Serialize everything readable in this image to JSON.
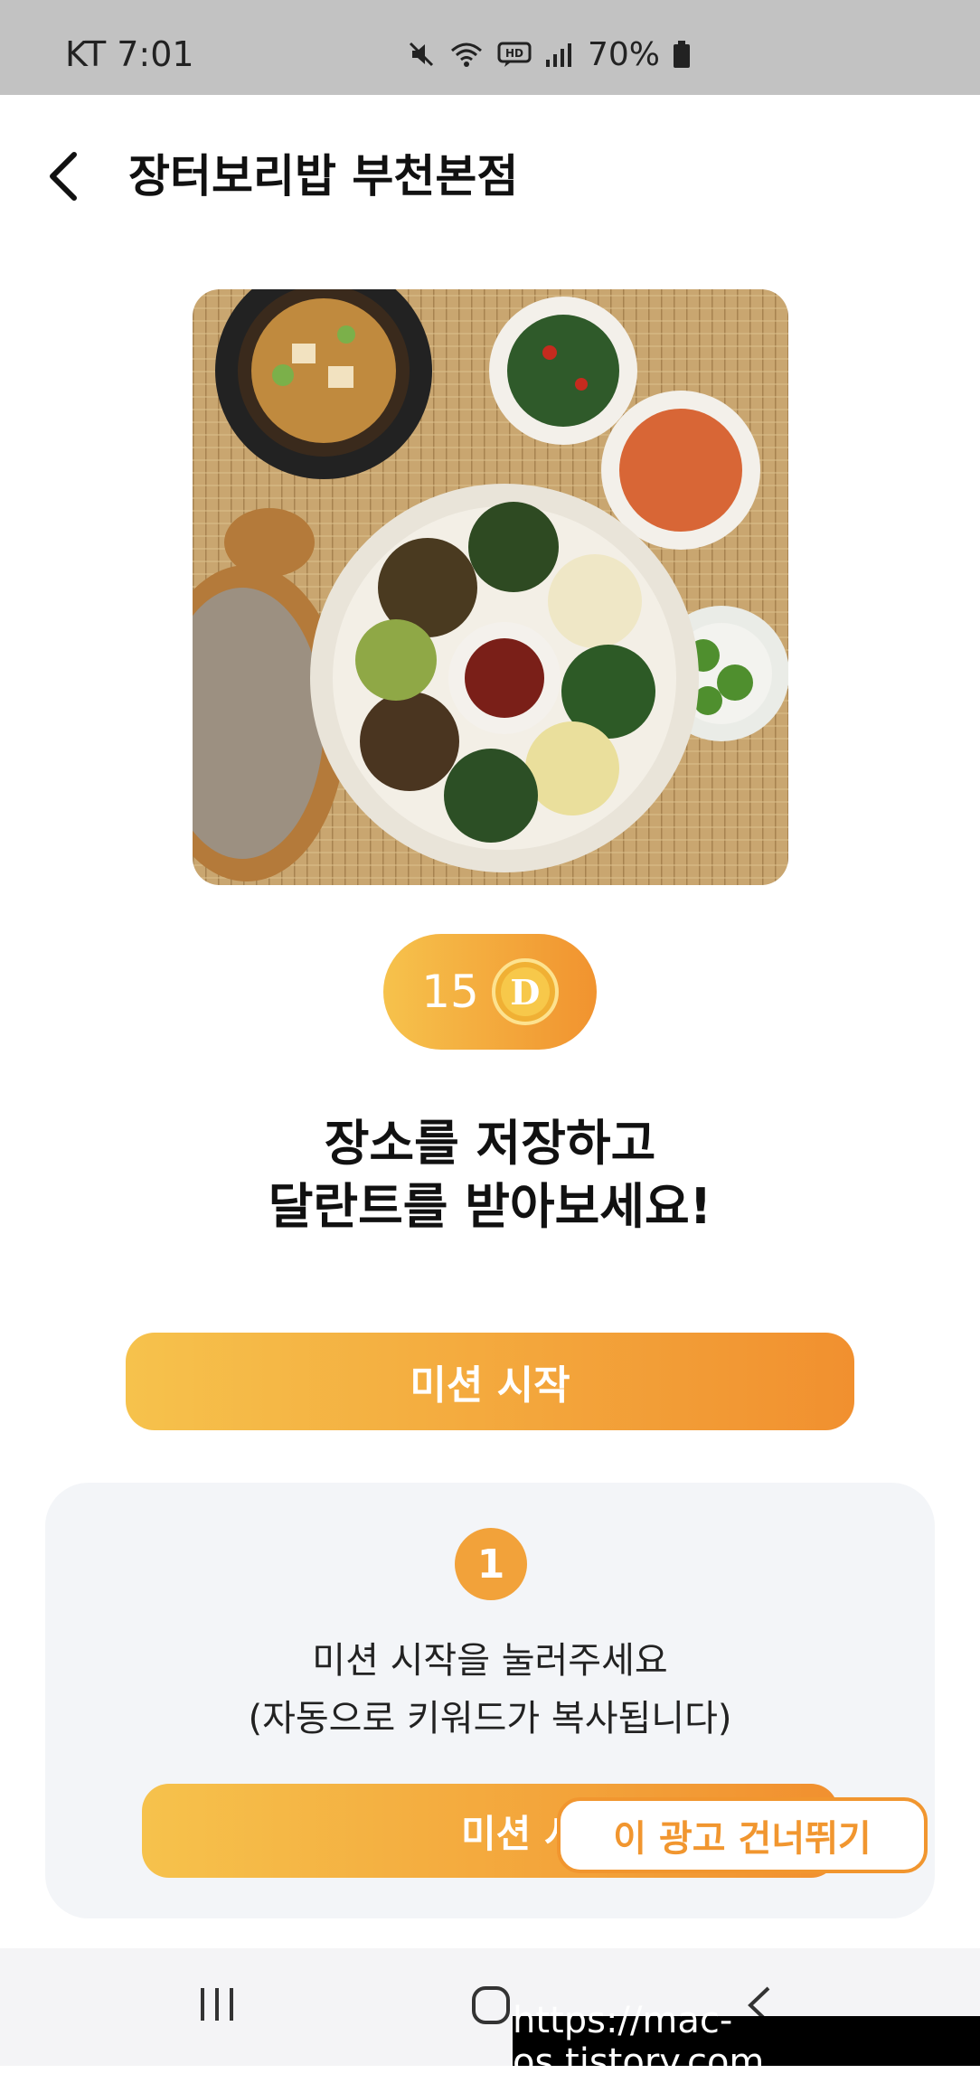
{
  "status_bar": {
    "carrier_time": "KT 7:01",
    "battery_percent": "70%",
    "icons": [
      "mute-icon",
      "wifi-icon",
      "hd-voice-icon",
      "signal-icon",
      "battery-icon"
    ]
  },
  "header": {
    "back_icon": "chevron-left-icon",
    "title": "장터보리밥 부천본점"
  },
  "reward": {
    "amount": "15",
    "coin_letter": "D"
  },
  "headline": {
    "line1": "장소를 저장하고",
    "line2": "달란트를 받아보세요!"
  },
  "mission_button": {
    "label": "미션 시작"
  },
  "steps_card": {
    "step_number": "1",
    "line1": "미션 시작을 눌러주세요",
    "line2": "(자동으로 키워드가 복사됩니다)",
    "button_label": "미션 시작"
  },
  "skip_ad": {
    "label": "이 광고 건너뛰기"
  },
  "nav_bar": {
    "icons": [
      "recents-icon",
      "home-icon",
      "back-icon"
    ]
  },
  "watermark": {
    "text": "https://mac-os.tistory.com"
  },
  "colors": {
    "accent_start": "#f6c24c",
    "accent_end": "#f1902f",
    "card_bg": "#f3f5f8",
    "status_bar_bg": "#c2c2c2"
  }
}
